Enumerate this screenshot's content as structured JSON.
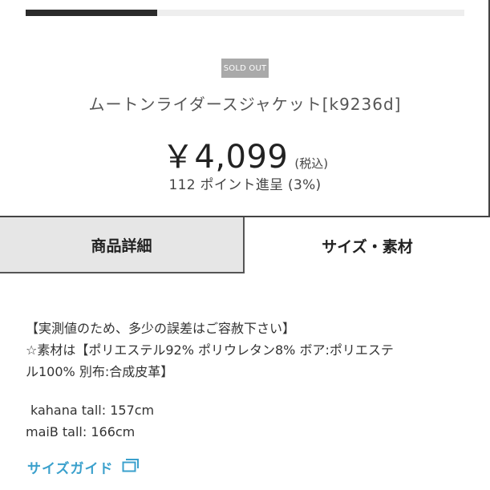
{
  "progress": {
    "fraction": 0.3
  },
  "product": {
    "badge": "SOLD OUT",
    "title": "ムートンライダースジャケット[k9236d]",
    "price": "￥4,099",
    "tax_note": "(税込)",
    "points": "112 ポイント進呈 (3%)"
  },
  "tabs": [
    {
      "label": "商品詳細",
      "selected": false
    },
    {
      "label": "サイズ・素材",
      "selected": true
    }
  ],
  "description": {
    "line1": "【実測値のため、多少の誤差はご容赦下さい】",
    "line2": "☆素材は【ポリエステル92% ポリウレタン8% ボア:ポリエステ",
    "line3": "ル100% 別布:合成皮革】",
    "line4": "kahana tall: 157cm",
    "line5": "maiB tall: 166cm"
  },
  "size_guide": {
    "label": "サイズガイド",
    "icon": "open-window-icon"
  },
  "colors": {
    "accent": "#3aa0cc",
    "badge_bg": "#a9a9a9",
    "tab_inactive_bg": "#e6e6e6"
  }
}
